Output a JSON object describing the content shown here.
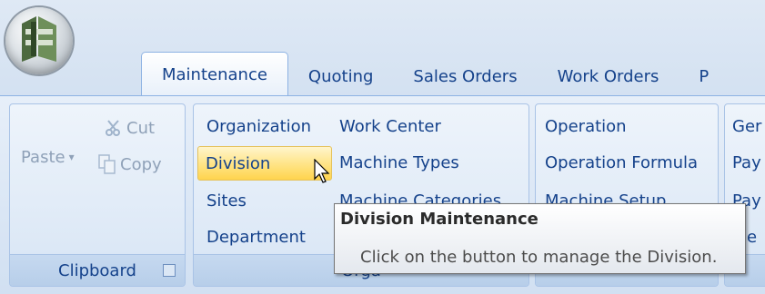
{
  "tabs": [
    {
      "label": "Maintenance",
      "active": true
    },
    {
      "label": "Quoting",
      "active": false
    },
    {
      "label": "Sales Orders",
      "active": false
    },
    {
      "label": "Work Orders",
      "active": false
    },
    {
      "label": "P",
      "active": false
    }
  ],
  "clipboard": {
    "paste": "Paste",
    "paste_arrow": "▾",
    "cut": "Cut",
    "copy": "Copy",
    "footer": "Clipboard"
  },
  "org_group": {
    "col1": [
      "Organization",
      "Division",
      "Sites",
      "Department"
    ],
    "col2": [
      "Work Center",
      "Machine Types",
      "Machine Categories"
    ],
    "footer": "Orga"
  },
  "ops_group": {
    "items": [
      "Operation",
      "Operation Formula",
      "Machine Setup"
    ]
  },
  "general_group": {
    "items": [
      "Ger",
      "Pay",
      "Pay",
      "ale"
    ]
  },
  "tooltip": {
    "title": "Division Maintenance",
    "body": "Click on the button to manage the Division."
  },
  "colors": {
    "ribbon_text": "#15428b",
    "hover_fill": "#ffd44d",
    "tab_border": "#8db2e3"
  }
}
